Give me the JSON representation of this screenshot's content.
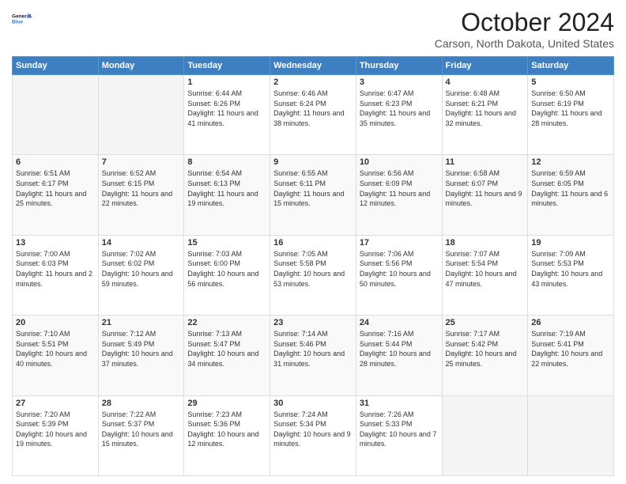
{
  "logo": {
    "line1": "General",
    "line2": "Blue"
  },
  "title": "October 2024",
  "subtitle": "Carson, North Dakota, United States",
  "header_days": [
    "Sunday",
    "Monday",
    "Tuesday",
    "Wednesday",
    "Thursday",
    "Friday",
    "Saturday"
  ],
  "weeks": [
    [
      {
        "day": "",
        "sunrise": "",
        "sunset": "",
        "daylight": ""
      },
      {
        "day": "",
        "sunrise": "",
        "sunset": "",
        "daylight": ""
      },
      {
        "day": "1",
        "sunrise": "Sunrise: 6:44 AM",
        "sunset": "Sunset: 6:26 PM",
        "daylight": "Daylight: 11 hours and 41 minutes."
      },
      {
        "day": "2",
        "sunrise": "Sunrise: 6:46 AM",
        "sunset": "Sunset: 6:24 PM",
        "daylight": "Daylight: 11 hours and 38 minutes."
      },
      {
        "day": "3",
        "sunrise": "Sunrise: 6:47 AM",
        "sunset": "Sunset: 6:23 PM",
        "daylight": "Daylight: 11 hours and 35 minutes."
      },
      {
        "day": "4",
        "sunrise": "Sunrise: 6:48 AM",
        "sunset": "Sunset: 6:21 PM",
        "daylight": "Daylight: 11 hours and 32 minutes."
      },
      {
        "day": "5",
        "sunrise": "Sunrise: 6:50 AM",
        "sunset": "Sunset: 6:19 PM",
        "daylight": "Daylight: 11 hours and 28 minutes."
      }
    ],
    [
      {
        "day": "6",
        "sunrise": "Sunrise: 6:51 AM",
        "sunset": "Sunset: 6:17 PM",
        "daylight": "Daylight: 11 hours and 25 minutes."
      },
      {
        "day": "7",
        "sunrise": "Sunrise: 6:52 AM",
        "sunset": "Sunset: 6:15 PM",
        "daylight": "Daylight: 11 hours and 22 minutes."
      },
      {
        "day": "8",
        "sunrise": "Sunrise: 6:54 AM",
        "sunset": "Sunset: 6:13 PM",
        "daylight": "Daylight: 11 hours and 19 minutes."
      },
      {
        "day": "9",
        "sunrise": "Sunrise: 6:55 AM",
        "sunset": "Sunset: 6:11 PM",
        "daylight": "Daylight: 11 hours and 15 minutes."
      },
      {
        "day": "10",
        "sunrise": "Sunrise: 6:56 AM",
        "sunset": "Sunset: 6:09 PM",
        "daylight": "Daylight: 11 hours and 12 minutes."
      },
      {
        "day": "11",
        "sunrise": "Sunrise: 6:58 AM",
        "sunset": "Sunset: 6:07 PM",
        "daylight": "Daylight: 11 hours and 9 minutes."
      },
      {
        "day": "12",
        "sunrise": "Sunrise: 6:59 AM",
        "sunset": "Sunset: 6:05 PM",
        "daylight": "Daylight: 11 hours and 6 minutes."
      }
    ],
    [
      {
        "day": "13",
        "sunrise": "Sunrise: 7:00 AM",
        "sunset": "Sunset: 6:03 PM",
        "daylight": "Daylight: 11 hours and 2 minutes."
      },
      {
        "day": "14",
        "sunrise": "Sunrise: 7:02 AM",
        "sunset": "Sunset: 6:02 PM",
        "daylight": "Daylight: 10 hours and 59 minutes."
      },
      {
        "day": "15",
        "sunrise": "Sunrise: 7:03 AM",
        "sunset": "Sunset: 6:00 PM",
        "daylight": "Daylight: 10 hours and 56 minutes."
      },
      {
        "day": "16",
        "sunrise": "Sunrise: 7:05 AM",
        "sunset": "Sunset: 5:58 PM",
        "daylight": "Daylight: 10 hours and 53 minutes."
      },
      {
        "day": "17",
        "sunrise": "Sunrise: 7:06 AM",
        "sunset": "Sunset: 5:56 PM",
        "daylight": "Daylight: 10 hours and 50 minutes."
      },
      {
        "day": "18",
        "sunrise": "Sunrise: 7:07 AM",
        "sunset": "Sunset: 5:54 PM",
        "daylight": "Daylight: 10 hours and 47 minutes."
      },
      {
        "day": "19",
        "sunrise": "Sunrise: 7:09 AM",
        "sunset": "Sunset: 5:53 PM",
        "daylight": "Daylight: 10 hours and 43 minutes."
      }
    ],
    [
      {
        "day": "20",
        "sunrise": "Sunrise: 7:10 AM",
        "sunset": "Sunset: 5:51 PM",
        "daylight": "Daylight: 10 hours and 40 minutes."
      },
      {
        "day": "21",
        "sunrise": "Sunrise: 7:12 AM",
        "sunset": "Sunset: 5:49 PM",
        "daylight": "Daylight: 10 hours and 37 minutes."
      },
      {
        "day": "22",
        "sunrise": "Sunrise: 7:13 AM",
        "sunset": "Sunset: 5:47 PM",
        "daylight": "Daylight: 10 hours and 34 minutes."
      },
      {
        "day": "23",
        "sunrise": "Sunrise: 7:14 AM",
        "sunset": "Sunset: 5:46 PM",
        "daylight": "Daylight: 10 hours and 31 minutes."
      },
      {
        "day": "24",
        "sunrise": "Sunrise: 7:16 AM",
        "sunset": "Sunset: 5:44 PM",
        "daylight": "Daylight: 10 hours and 28 minutes."
      },
      {
        "day": "25",
        "sunrise": "Sunrise: 7:17 AM",
        "sunset": "Sunset: 5:42 PM",
        "daylight": "Daylight: 10 hours and 25 minutes."
      },
      {
        "day": "26",
        "sunrise": "Sunrise: 7:19 AM",
        "sunset": "Sunset: 5:41 PM",
        "daylight": "Daylight: 10 hours and 22 minutes."
      }
    ],
    [
      {
        "day": "27",
        "sunrise": "Sunrise: 7:20 AM",
        "sunset": "Sunset: 5:39 PM",
        "daylight": "Daylight: 10 hours and 19 minutes."
      },
      {
        "day": "28",
        "sunrise": "Sunrise: 7:22 AM",
        "sunset": "Sunset: 5:37 PM",
        "daylight": "Daylight: 10 hours and 15 minutes."
      },
      {
        "day": "29",
        "sunrise": "Sunrise: 7:23 AM",
        "sunset": "Sunset: 5:36 PM",
        "daylight": "Daylight: 10 hours and 12 minutes."
      },
      {
        "day": "30",
        "sunrise": "Sunrise: 7:24 AM",
        "sunset": "Sunset: 5:34 PM",
        "daylight": "Daylight: 10 hours and 9 minutes."
      },
      {
        "day": "31",
        "sunrise": "Sunrise: 7:26 AM",
        "sunset": "Sunset: 5:33 PM",
        "daylight": "Daylight: 10 hours and 7 minutes."
      },
      {
        "day": "",
        "sunrise": "",
        "sunset": "",
        "daylight": ""
      },
      {
        "day": "",
        "sunrise": "",
        "sunset": "",
        "daylight": ""
      }
    ]
  ]
}
